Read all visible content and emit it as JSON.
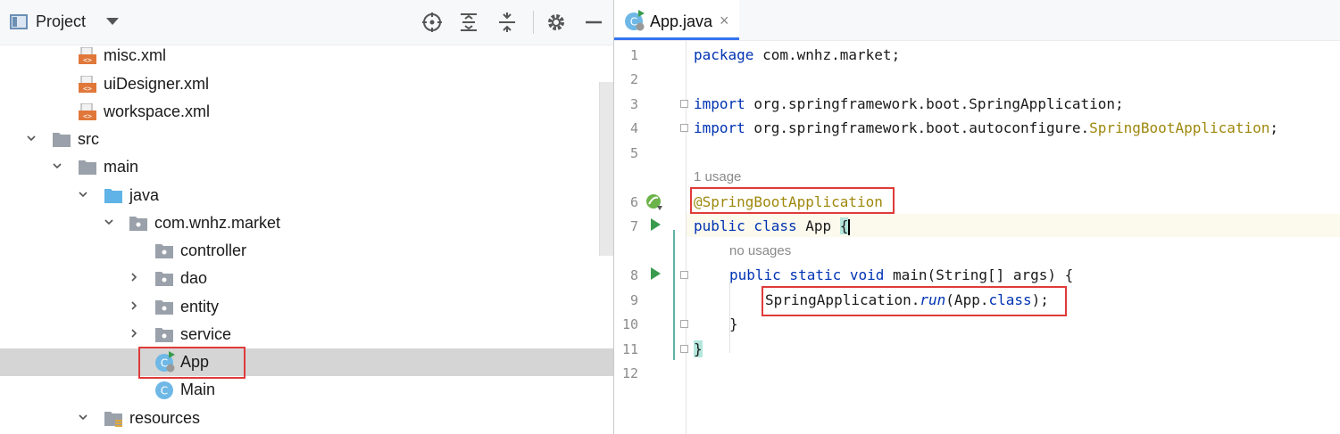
{
  "project_panel": {
    "title": "Project",
    "toolbar_icons": [
      "locate-icon",
      "expand-all-icon",
      "collapse-all-icon",
      "gear-icon",
      "hide-icon"
    ]
  },
  "tree": [
    {
      "label": "misc.xml",
      "icon": "xml-file-icon",
      "expandable": false,
      "expanded": false,
      "selected": false
    },
    {
      "label": "uiDesigner.xml",
      "icon": "xml-file-icon",
      "expandable": false,
      "expanded": false,
      "selected": false
    },
    {
      "label": "workspace.xml",
      "icon": "xml-file-icon",
      "expandable": false,
      "expanded": false,
      "selected": false
    },
    {
      "label": "src",
      "icon": "folder-icon",
      "expandable": true,
      "expanded": true,
      "selected": false
    },
    {
      "label": "main",
      "icon": "folder-icon",
      "expandable": true,
      "expanded": true,
      "selected": false
    },
    {
      "label": "java",
      "icon": "source-folder-icon",
      "expandable": true,
      "expanded": true,
      "selected": false
    },
    {
      "label": "com.wnhz.market",
      "icon": "package-icon",
      "expandable": true,
      "expanded": true,
      "selected": false
    },
    {
      "label": "controller",
      "icon": "package-icon",
      "expandable": false,
      "expanded": false,
      "selected": false
    },
    {
      "label": "dao",
      "icon": "package-icon",
      "expandable": true,
      "expanded": false,
      "selected": false
    },
    {
      "label": "entity",
      "icon": "package-icon",
      "expandable": true,
      "expanded": false,
      "selected": false
    },
    {
      "label": "service",
      "icon": "package-icon",
      "expandable": true,
      "expanded": false,
      "selected": false
    },
    {
      "label": "App",
      "icon": "spring-class-icon",
      "expandable": false,
      "expanded": false,
      "selected": true
    },
    {
      "label": "Main",
      "icon": "java-class-icon",
      "expandable": false,
      "expanded": false,
      "selected": false
    },
    {
      "label": "resources",
      "icon": "resources-folder-icon",
      "expandable": true,
      "expanded": true,
      "selected": false
    }
  ],
  "editor": {
    "tab": {
      "label": "App.java",
      "close": "×"
    },
    "line_numbers": [
      "1",
      "2",
      "3",
      "4",
      "5",
      "6",
      "7",
      "8",
      "9",
      "10",
      "11",
      "12"
    ],
    "hints": {
      "usage_1": "1 usage",
      "usage_2": "no usages"
    },
    "code": {
      "l1_kw": "package",
      "l1_rest": " com.wnhz.market;",
      "l3_kw": "import",
      "l3_rest": " org.springframework.boot.SpringApplication;",
      "l4_kw": "import",
      "l4_rest": " org.springframework.boot.autoconfigure.",
      "l4_ann": "SpringBootApplication",
      "l4_end": ";",
      "l6_ann": "@SpringBootApplication",
      "l7_kw": "public class",
      "l7_name": " App ",
      "l7_brace": "{",
      "l8_kw": "public static void",
      "l8_rest": " main(String[] args) {",
      "l9_a": "SpringApplication.",
      "l9_run": "run",
      "l9_b": "(App.",
      "l9_kw": "class",
      "l9_c": ");",
      "l10": "}",
      "l11": "}"
    },
    "colors": {
      "keyword": "#0033b3",
      "annotation": "#9e880d",
      "highlight_box": "#e03a3a"
    }
  }
}
